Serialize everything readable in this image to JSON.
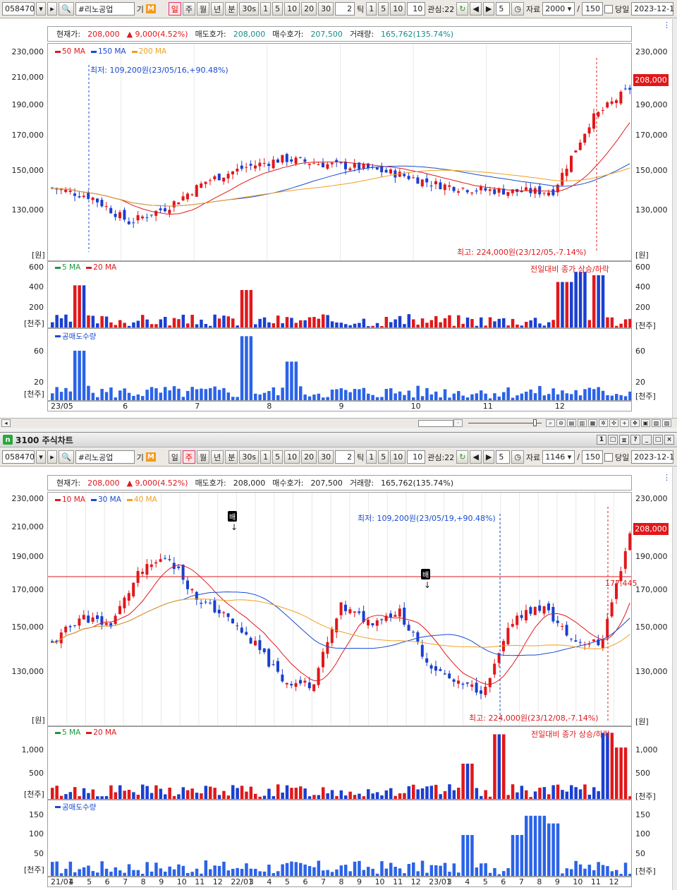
{
  "toolbar": {
    "code": "058470",
    "name": "#리노공업",
    "radio": [
      "일",
      "주",
      "월",
      "년",
      "분",
      "30s",
      "1",
      "5",
      "10",
      "20",
      "30"
    ],
    "tick_num": "2",
    "tick_label": "틱",
    "tick_opts": [
      "1",
      "5",
      "10"
    ],
    "tick_val": "10",
    "gwansim": "관심:22",
    "spin_val": "5",
    "data_label": "자료",
    "per_label": "150",
    "same_day": "당일",
    "date": "2023-12-1",
    "gi": "기",
    "m_mark": "M"
  },
  "toolbar2": {
    "data_count": "1146"
  },
  "info": {
    "label_price": "현재가:",
    "price": "208,000",
    "change": "▲ 9,000(4.52%)",
    "label_ask": "매도호가:",
    "ask": "208,000",
    "label_bid": "매수호가:",
    "bid": "207,500",
    "label_vol": "거래량:",
    "vol": "165,762(135.74%)"
  },
  "c1": {
    "legend": [
      "50 MA",
      "150 MA",
      "200 MA"
    ],
    "legend_colors": [
      "#e0181b",
      "#1a4bd0",
      "#f0a01e"
    ],
    "y_ticks": [
      "230,000",
      "210,000",
      "190,000",
      "170,000",
      "150,000",
      "130,000"
    ],
    "unit": "[원]",
    "low_note": "최저: 109,200원(23/05/16,+90.48%)",
    "high_note": "최고: 224,000원(23/12/05,-7.14%)",
    "price_tag": "208,000",
    "vol_legend": [
      "5 MA",
      "20 MA"
    ],
    "vol_legend_colors": [
      "#1a9a3a",
      "#e0181b"
    ],
    "vol_ticks": [
      "600",
      "400",
      "200"
    ],
    "vol_unit": "[천주]",
    "vol_note": "전일대비 종가 상승/하락",
    "short_legend": "공매도수량",
    "short_ticks": [
      "60",
      "20"
    ],
    "short_unit": "[천주]",
    "x_labels": [
      "23/05",
      "6",
      "7",
      "8",
      "9",
      "10",
      "11",
      "12"
    ]
  },
  "c2": {
    "legend": [
      "10 MA",
      "30 MA",
      "40 MA"
    ],
    "legend_colors": [
      "#e0181b",
      "#1a4bd0",
      "#f0a01e"
    ],
    "y_ticks": [
      "230,000",
      "210,000",
      "190,000",
      "170,000",
      "150,000",
      "130,000"
    ],
    "unit": "[원]",
    "low_note": "최저: 109,200원(23/05/19,+90.48%)",
    "high_note": "최고: 224,000원(23/12/08,-7.14%)",
    "price_tag": "208,000",
    "hline_label": "177,445",
    "bae": "배",
    "vol_legend": [
      "5 MA",
      "20 MA"
    ],
    "vol_legend_colors": [
      "#1a9a3a",
      "#e0181b"
    ],
    "vol_ticks": [
      "1,000",
      "500"
    ],
    "vol_unit": "[천주]",
    "vol_note": "전일대비 종가 상승/하락",
    "short_legend": "공매도수량",
    "short_ticks": [
      "150",
      "100",
      "50"
    ],
    "short_unit": "[천주]",
    "x_labels": [
      "21/01",
      "4",
      "5",
      "6",
      "7",
      "8",
      "9",
      "10",
      "11",
      "12",
      "22/01",
      "3",
      "4",
      "5",
      "6",
      "7",
      "8",
      "9",
      "10",
      "11",
      "12",
      "23/01",
      "3",
      "4",
      "5",
      "6",
      "7",
      "8",
      "9",
      "10",
      "11",
      "12"
    ]
  },
  "window": {
    "title": "3100 주식차트",
    "btns": [
      "1",
      "□",
      "ㅍ",
      "?",
      "_",
      "□",
      "×"
    ]
  }
}
